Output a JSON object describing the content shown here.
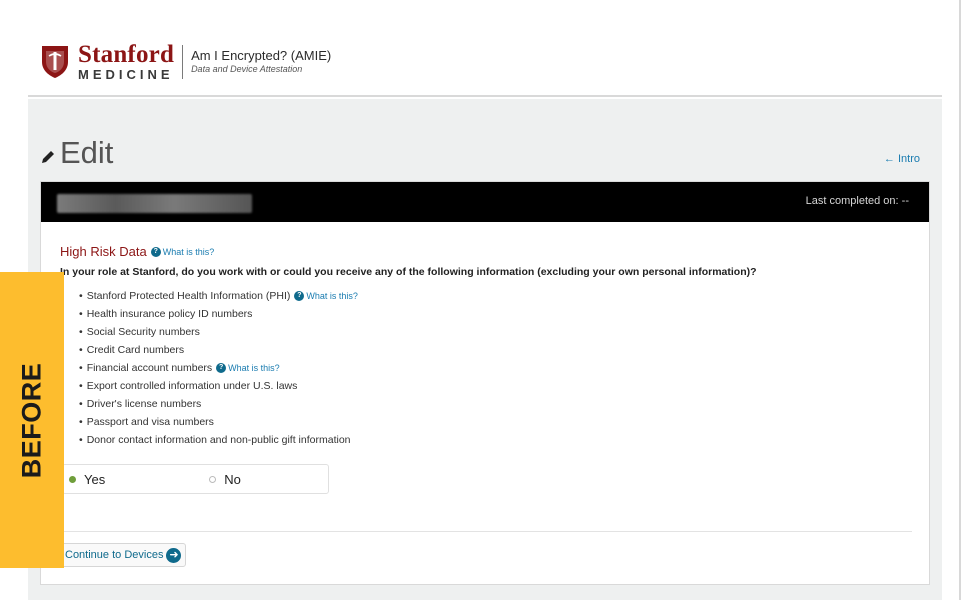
{
  "header": {
    "brand_top": "Stanford",
    "brand_bottom": "MEDICINE",
    "app_title": "Am I Encrypted? (AMIE)",
    "app_subtitle": "Data and Device Attestation",
    "brand_color": "#8c1515"
  },
  "page": {
    "title": "Edit",
    "intro_link": "← Intro"
  },
  "card": {
    "last_completed": "Last completed on: --",
    "section_title": "High Risk Data",
    "section_help": "What is this?",
    "question": "In your role at Stanford, do you work with or could you receive any of the following information (excluding your own personal information)?",
    "items": [
      {
        "label": "Stanford Protected Health Information (PHI)",
        "help": "What is this?"
      },
      {
        "label": "Health insurance policy ID numbers",
        "help": ""
      },
      {
        "label": "Social Security numbers",
        "help": ""
      },
      {
        "label": "Credit Card numbers",
        "help": ""
      },
      {
        "label": "Financial account numbers",
        "help": "What is this?"
      },
      {
        "label": "Export controlled information under U.S. laws",
        "help": ""
      },
      {
        "label": "Driver's license numbers",
        "help": ""
      },
      {
        "label": "Passport and visa numbers",
        "help": ""
      },
      {
        "label": "Donor contact information and non-public gift information",
        "help": ""
      }
    ],
    "radio_yes": "Yes",
    "radio_no": "No",
    "selected": "Yes",
    "continue_label": "Continue to Devices"
  },
  "overlay": {
    "before_label": "BEFORE",
    "color": "#fdbd2e"
  },
  "icons": {
    "logo": "stanford-shield-icon",
    "edit": "pencil-icon",
    "help": "question-circle-icon",
    "continue": "arrow-circle-right-icon"
  }
}
